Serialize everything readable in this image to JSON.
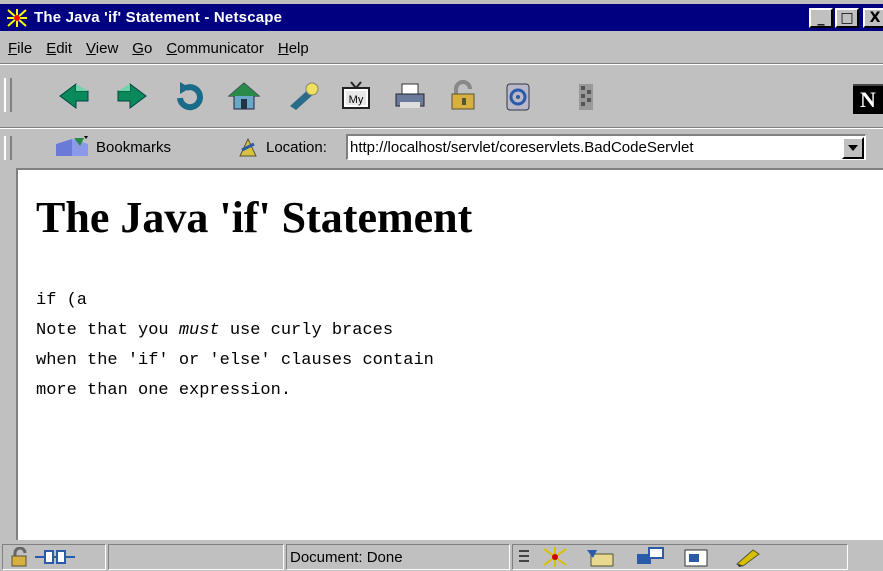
{
  "window": {
    "title": "The Java 'if' Statement - Netscape",
    "buttons": {
      "minimize": "_",
      "maximize": "□",
      "close": "X"
    }
  },
  "menu": {
    "items": [
      {
        "mn": "F",
        "rest": "ile"
      },
      {
        "mn": "E",
        "rest": "dit"
      },
      {
        "mn": "V",
        "rest": "iew"
      },
      {
        "mn": "G",
        "rest": "o"
      },
      {
        "mn": "C",
        "rest": "ommunicator"
      },
      {
        "mn": "H",
        "rest": "elp"
      }
    ]
  },
  "toolbar": {
    "buttons": [
      "back-icon",
      "forward-icon",
      "reload-icon",
      "home-icon",
      "search-icon",
      "guide-icon",
      "print-icon",
      "security-icon",
      "shop-icon",
      "stop-icon"
    ],
    "logo": "N"
  },
  "location_bar": {
    "bookmarks_label": "Bookmarks",
    "location_label": "Location:",
    "url": "http://localhost/servlet/coreservlets.BadCodeServlet"
  },
  "page": {
    "heading": "The Java 'if' Statement",
    "code_line1": "if (a",
    "code_line2_before": "Note that you ",
    "code_line2_em": "must",
    "code_line2_after": " use curly braces",
    "code_line3": "when the 'if' or 'else' clauses contain",
    "code_line4": "more than one expression."
  },
  "status_bar": {
    "text": "Document: Done",
    "icons": [
      "lock-icon",
      "connection-icon",
      "component-navigator-icon",
      "messenger-icon",
      "mail-icon",
      "discussion-icon",
      "composer-icon"
    ]
  },
  "colors": {
    "titlebar": "#000080",
    "chrome": "#c0c0c0",
    "content_bg": "#ffffff"
  }
}
